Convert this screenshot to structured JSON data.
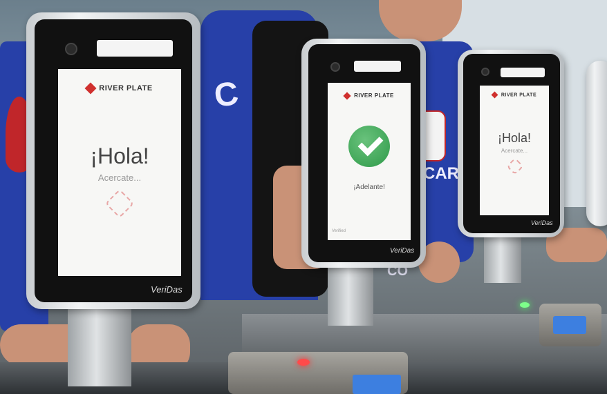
{
  "scene": {
    "kiosk_left": {
      "logo": "RIVER PLATE",
      "greeting": "¡Hola!",
      "subtitle": "Acercate...",
      "brand": "VeriDas"
    },
    "kiosk_center": {
      "logo": "RIVER PLATE",
      "status_text": "¡Adelante!",
      "footer_left": "Verified",
      "brand": "VeriDas"
    },
    "kiosk_right": {
      "logo": "RIVER PLATE",
      "greeting": "¡Hola!",
      "subtitle": "Acercate...",
      "brand": "VeriDas"
    },
    "jersey_text_1": "C",
    "jersey_text_2": "CARP",
    "jersey_text_3": "CO"
  },
  "colors": {
    "jersey_blue": "#2740a8",
    "success_green": "#3aa653",
    "brand_red": "#d0302e",
    "screen_white": "#f7f7f5"
  },
  "icons": [
    "camera-icon",
    "check-icon",
    "river-plate-logo-icon",
    "face-emblem-icon"
  ]
}
